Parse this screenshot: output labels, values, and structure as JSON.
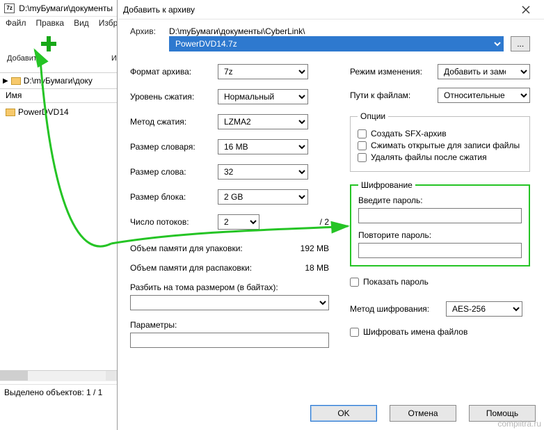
{
  "fm": {
    "title": "D:\\myБумаги\\документы",
    "menu": [
      "Файл",
      "Правка",
      "Вид",
      "Избр"
    ],
    "toolbar": {
      "add": "Добавить",
      "extract": "Извлечь"
    },
    "path": "D:\\myБумаги\\доку",
    "header": "Имя",
    "item": "PowerDVD14",
    "status": "Выделено объектов: 1 / 1"
  },
  "dlg": {
    "title": "Добавить к архиву",
    "archive_lbl": "Архив:",
    "archive_path": "D:\\myБумаги\\документы\\CyberLink\\",
    "archive_file": "PowerDVD14.7z",
    "browse": "...",
    "format_lbl": "Формат архива:",
    "format_val": "7z",
    "level_lbl": "Уровень сжатия:",
    "level_val": "Нормальный",
    "method_lbl": "Метод сжатия:",
    "method_val": "LZMA2",
    "dict_lbl": "Размер словаря:",
    "dict_val": "16 MB",
    "word_lbl": "Размер слова:",
    "word_val": "32",
    "block_lbl": "Размер блока:",
    "block_val": "2 GB",
    "threads_lbl": "Число потоков:",
    "threads_val": "2",
    "threads_max": "/ 2",
    "mem_pack_lbl": "Объем памяти для упаковки:",
    "mem_pack_val": "192 MB",
    "mem_unpack_lbl": "Объем памяти для распаковки:",
    "mem_unpack_val": "18 MB",
    "split_lbl": "Разбить на тома размером (в байтах):",
    "params_lbl": "Параметры:",
    "mode_lbl": "Режим изменения:",
    "mode_val": "Добавить и заменить",
    "paths_lbl": "Пути к файлам:",
    "paths_val": "Относительные пути",
    "opts_legend": "Опции",
    "opt_sfx": "Создать SFX-архив",
    "opt_open": "Сжимать открытые для записи файлы",
    "opt_del": "Удалять файлы после сжатия",
    "enc_legend": "Шифрование",
    "enc_pw1": "Введите пароль:",
    "enc_pw2": "Повторите пароль:",
    "enc_show": "Показать пароль",
    "enc_method_lbl": "Метод шифрования:",
    "enc_method_val": "AES-256",
    "enc_names": "Шифровать имена файлов",
    "ok": "OK",
    "cancel": "Отмена",
    "help": "Помощь"
  },
  "watermark": "complitra.ru"
}
